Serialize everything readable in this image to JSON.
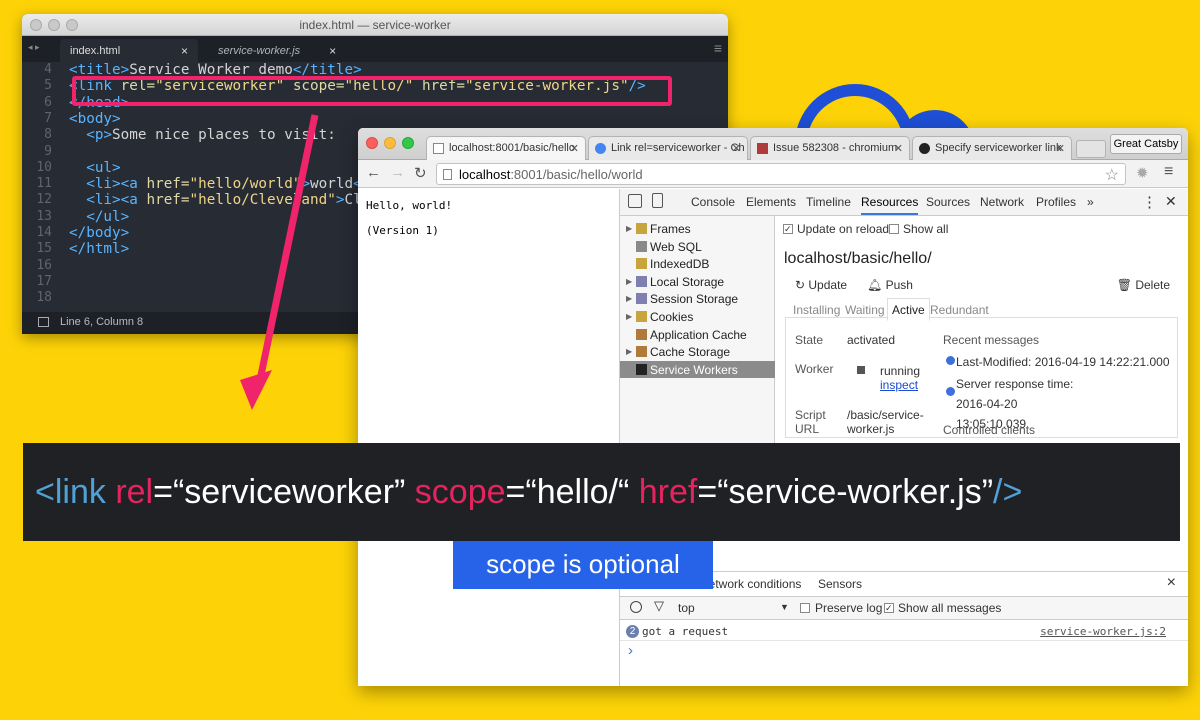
{
  "editor": {
    "title": "index.html — service-worker",
    "tabs": [
      {
        "label": "index.html",
        "close": "×"
      },
      {
        "label": "service-worker.js",
        "close": "×"
      }
    ],
    "lines": [
      {
        "n": "4",
        "html": "<span class=\"t\">&lt;title&gt;</span>Service Worker demo<span class=\"t\">&lt;/title&gt;</span>"
      },
      {
        "n": "5",
        "html": "<span class=\"t\">&lt;link</span> <span class=\"a\">rel=</span><span class=\"s\">\"serviceworker\"</span> <span class=\"a\">scope=</span><span class=\"s\">\"hello/\"</span> <span class=\"a\">href=</span><span class=\"s\">\"service-worker.js\"</span><span class=\"t\">/&gt;</span>"
      },
      {
        "n": "6",
        "html": "<span class=\"t\">&lt;/head&gt;</span>"
      },
      {
        "n": "7",
        "html": "<span class=\"t\">&lt;body&gt;</span>"
      },
      {
        "n": "8",
        "html": "  <span class=\"t\">&lt;p&gt;</span>Some nice places to visit:"
      },
      {
        "n": "9",
        "html": ""
      },
      {
        "n": "10",
        "html": "  <span class=\"t\">&lt;ul&gt;</span>"
      },
      {
        "n": "11",
        "html": "  <span class=\"t\">&lt;li&gt;&lt;a</span> <span class=\"a\">href=</span><span class=\"s\">\"hello/world\"</span><span class=\"t\">&gt;</span>world<span class=\"t\">&lt;</span>"
      },
      {
        "n": "12",
        "html": "  <span class=\"t\">&lt;li&gt;&lt;a</span> <span class=\"a\">href=</span><span class=\"s\">\"hello/Cleveland\"</span><span class=\"t\">&gt;</span>Cl"
      },
      {
        "n": "13",
        "html": "  <span class=\"t\">&lt;/ul&gt;</span>"
      },
      {
        "n": "14",
        "html": "<span class=\"t\">&lt;/body&gt;</span>"
      },
      {
        "n": "15",
        "html": "<span class=\"t\">&lt;/html&gt;</span>"
      },
      {
        "n": "16",
        "html": ""
      },
      {
        "n": "17",
        "html": ""
      },
      {
        "n": "18",
        "html": ""
      }
    ],
    "status": "Line 6, Column 8"
  },
  "browser": {
    "tabs": [
      {
        "label": "localhost:8001/basic/hello"
      },
      {
        "label": "Link rel=serviceworker - Ch"
      },
      {
        "label": "Issue 582308 - chromium"
      },
      {
        "label": "Specify serviceworker link"
      }
    ],
    "user": "Great Catsby",
    "url_host": "localhost",
    "url_path": ":8001/basic/hello/world",
    "page_lines": [
      "Hello, world!",
      "(Version 1)"
    ],
    "devtools_tabs": [
      "Console",
      "Elements",
      "Timeline",
      "Resources",
      "Sources",
      "Network",
      "Profiles",
      "»"
    ],
    "sidebar": [
      "Frames",
      "Web SQL",
      "IndexedDB",
      "Local Storage",
      "Session Storage",
      "Cookies",
      "Application Cache",
      "Cache Storage",
      "Service Workers"
    ],
    "update_on_reload": "Update on reload",
    "show_all": "Show all",
    "sw_scope": "localhost/basic/hello/",
    "actions": {
      "update": "Update",
      "push": "Push",
      "delete": "Delete"
    },
    "subtabs": [
      "Installing",
      "Waiting",
      "Active",
      "Redundant"
    ],
    "state_label": "State",
    "state_value": "activated",
    "worker_label": "Worker",
    "worker_value": "running",
    "inspect": "inspect",
    "script_label": "Script URL",
    "script_value": "/basic/service-worker.js",
    "recent_messages": "Recent messages",
    "msg1": "Last-Modified: 2016-04-19 14:22:21.000",
    "msg2": "Server response time: 2016-04-20 13:05:10.039",
    "controlled_clients": "Controlled clients",
    "console_tabs": [
      "Network conditions",
      "Sensors"
    ],
    "console_tabs_close": "×",
    "context": "top",
    "preserve_log": "Preserve log",
    "show_all_messages": "Show all messages",
    "log_count": "2",
    "log_text": "got a request",
    "log_source": "service-worker.js:2",
    "prompt": "›"
  },
  "banner": {
    "parts": [
      {
        "cls": "bt",
        "text": "<link"
      },
      {
        "cls": "",
        "text": " "
      },
      {
        "cls": "ba",
        "text": "rel"
      },
      {
        "cls": "",
        "text": "=“serviceworker” "
      },
      {
        "cls": "ba",
        "text": "scope"
      },
      {
        "cls": "",
        "text": "=“hello/“ "
      },
      {
        "cls": "ba",
        "text": "href"
      },
      {
        "cls": "",
        "text": "=“service-worker.js”"
      },
      {
        "cls": "bt",
        "text": "/>"
      }
    ],
    "note": "scope is optional"
  }
}
